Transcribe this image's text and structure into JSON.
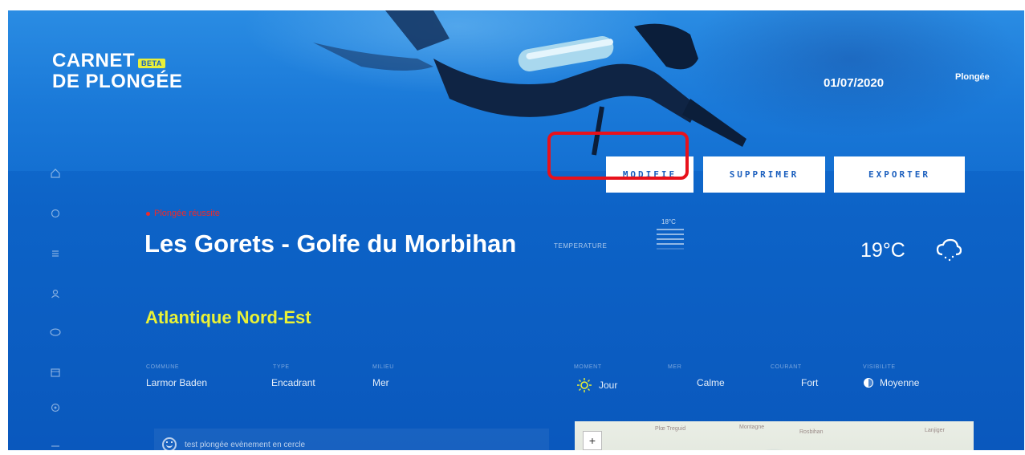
{
  "header": {
    "logo_line1": "CARNET",
    "logo_badge": "BETA",
    "logo_line2": "DE PLONGÉE",
    "date": "01/07/2020",
    "user_menu": "Plongée"
  },
  "actions": {
    "modify": "MODIFIE",
    "delete": "SUPPRIMER",
    "export": "EXPORTER"
  },
  "dive": {
    "badge": "Plongée réussite",
    "title": "Les Gorets - Golfe du Morbihan",
    "region": "Atlantique Nord-Est"
  },
  "temperature": {
    "label": "TEMPERATURE",
    "scale_top": "18°C",
    "value": "19°C"
  },
  "details": [
    {
      "label": "COMMUNE",
      "value": "Larmor Baden"
    },
    {
      "label": "TYPE",
      "value": "Encadrant"
    },
    {
      "label": "MILIEU",
      "value": "Mer"
    },
    {
      "label": "MOMENT",
      "value": "Jour"
    },
    {
      "label": "MER",
      "value": "Calme"
    },
    {
      "label": "COURANT",
      "value": "Fort"
    },
    {
      "label": "VISIBILITE",
      "value": "Moyenne"
    }
  ],
  "note": {
    "text": "test plongée evènement en cercle"
  },
  "map": {
    "zoom_in": "+",
    "places": [
      "Plœ Treguid",
      "Montagne",
      "Rosbihan",
      "Lanjiger"
    ]
  },
  "icons": [
    "home-icon",
    "dive-icon",
    "list-icon",
    "user-icon",
    "spot-icon",
    "calendar-icon",
    "settings-icon",
    "menu-icon",
    "sun-icon",
    "cloud-rain-icon",
    "half-moon-icon",
    "smiley-icon"
  ],
  "colors": {
    "background": "#0d63c7",
    "accent_yellow": "#eaf236",
    "success_red": "#ee2a2a",
    "highlight_border": "#e8111b",
    "button_text": "#1b5fbe"
  }
}
